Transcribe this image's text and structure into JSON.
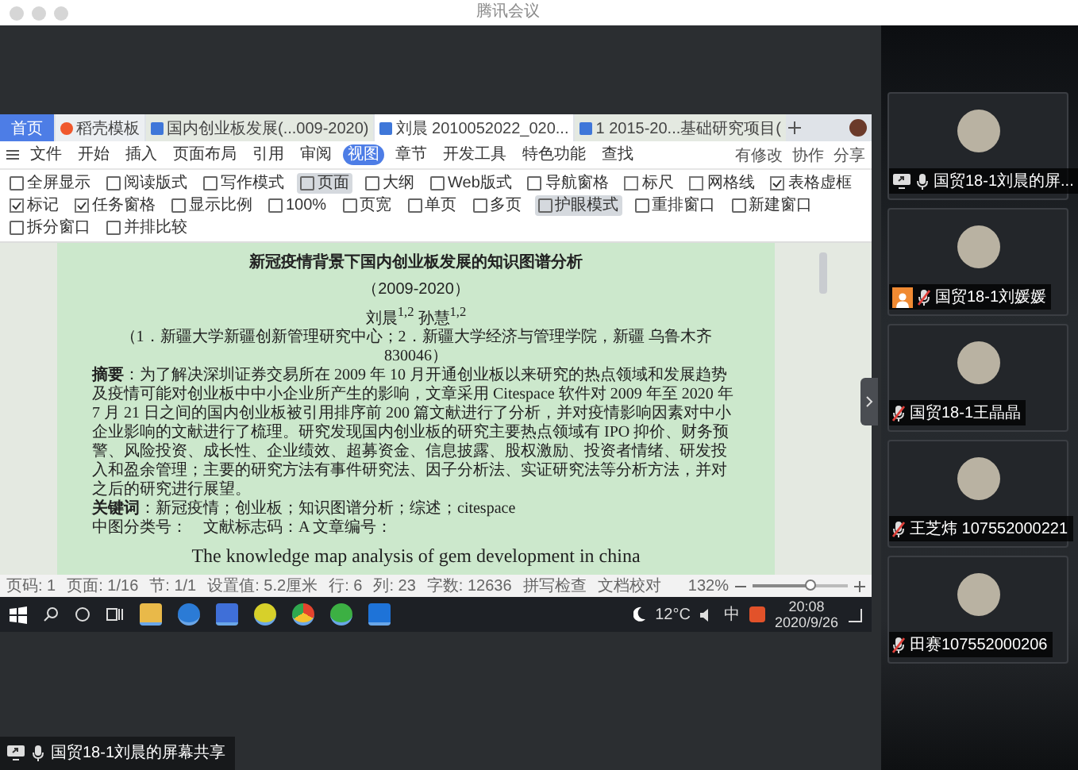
{
  "window": {
    "title": "腾讯会议"
  },
  "shared_screen": {
    "tabs": [
      {
        "label": "首页",
        "kind": "home",
        "selected": true
      },
      {
        "label": "稻壳模板",
        "kind": "docer",
        "selected": false
      },
      {
        "label": "国内创业板发展(...009-2020)",
        "kind": "doc",
        "selected": false
      },
      {
        "label": "刘晨 2010052022_020...",
        "kind": "doc",
        "selected": true
      },
      {
        "label": "1 2015-20...基础研究项目(",
        "kind": "doc",
        "selected": false
      }
    ],
    "menu": [
      {
        "label": "文件",
        "selected": false
      },
      {
        "label": "开始",
        "selected": false
      },
      {
        "label": "插入",
        "selected": false
      },
      {
        "label": "页面布局",
        "selected": false
      },
      {
        "label": "引用",
        "selected": false
      },
      {
        "label": "审阅",
        "selected": false
      },
      {
        "label": "视图",
        "selected": true
      },
      {
        "label": "章节",
        "selected": false
      },
      {
        "label": "开发工具",
        "selected": false
      },
      {
        "label": "特色功能",
        "selected": false
      },
      {
        "label": "查找",
        "selected": false
      }
    ],
    "menu_actions": [
      "有修改",
      "协作",
      "分享"
    ],
    "ribbon": [
      {
        "label": "全屏显示",
        "kind": "button",
        "selected": false
      },
      {
        "label": "阅读版式",
        "kind": "button",
        "selected": false
      },
      {
        "label": "写作模式",
        "kind": "button",
        "selected": false
      },
      {
        "label": "页面",
        "kind": "button",
        "selected": true
      },
      {
        "label": "大纲",
        "kind": "button",
        "selected": false
      },
      {
        "label": "Web版式",
        "kind": "button",
        "selected": false
      },
      {
        "label": "导航窗格",
        "kind": "button",
        "selected": false
      },
      {
        "label": "标尺",
        "kind": "checkbox",
        "checked": false
      },
      {
        "label": "网格线",
        "kind": "checkbox",
        "checked": false
      },
      {
        "label": "表格虚框",
        "kind": "checkbox",
        "checked": true
      },
      {
        "label": "标记",
        "kind": "checkbox",
        "checked": true
      },
      {
        "label": "任务窗格",
        "kind": "checkbox",
        "checked": true
      },
      {
        "label": "显示比例",
        "kind": "button",
        "selected": false
      },
      {
        "label": "100%",
        "kind": "button",
        "selected": false
      },
      {
        "label": "页宽",
        "kind": "button",
        "selected": false
      },
      {
        "label": "单页",
        "kind": "button",
        "selected": false
      },
      {
        "label": "多页",
        "kind": "button",
        "selected": false
      },
      {
        "label": "护眼模式",
        "kind": "button",
        "selected": true
      },
      {
        "label": "重排窗口",
        "kind": "button",
        "selected": false
      },
      {
        "label": "新建窗口",
        "kind": "button",
        "selected": false
      },
      {
        "label": "拆分窗口",
        "kind": "button",
        "selected": false
      },
      {
        "label": "并排比较",
        "kind": "button",
        "selected": false
      }
    ],
    "document": {
      "title": "新冠疫情背景下国内创业板发展的知识图谱分析",
      "subtitle": "（2009-2020）",
      "authors": "刘晨$^{1,2}$ 孙慧$^{1,2}$",
      "affiliation": "（1．新疆大学新疆创新管理研究中心；2．新疆大学经济与管理学院，新疆 乌鲁木齐 830046）",
      "abstract": "**摘要**：为了解决深圳证券交易所在 2009 年 10 月开通创业板以来研究的热点领域和发展趋势及疫情可能对创业板中中小企业所产生的影响，文章采用 Citespace 软件对 2009 年至 2020 年 7 月 21 日之间的国内创业板被引用排序前 200 篇文献进行了分析，并对疫情影响因素对中小企业影响的文献进行了梳理。研究发现国内创业板的研究主要热点领域有 IPO 抑价、财务预警、风险投资、成长性、企业绩效、超募资金、信息披露、股权激励、投资者情绪、研发投入和盈余管理；主要的研究方法有事件研究法、因子分析法、实证研究法等分析方法，并对之后的研究进行展望。",
      "keywords": "**关键词**：新冠疫情；创业板；知识图谱分析；综述；citespace",
      "classification": "中图分类号：　文献标志码：A 文章编号：",
      "english_title": "The knowledge map analysis of gem development in china"
    },
    "status_bar": {
      "items": [
        "页码: 1",
        "页面: 1/16",
        "节: 1/1",
        "设置值: 5.2厘米",
        "行: 6",
        "列: 23",
        "字数: 12636",
        "拼写检查",
        "文档校对"
      ],
      "zoom": "132%",
      "zoom_slider": {
        "level": 0.6
      }
    },
    "taskbar": {
      "weather": "12°C",
      "input_method": "中",
      "time": "20:08",
      "date": "2020/9/26"
    }
  },
  "participants": [
    {
      "name": "国贸18-1刘晨的屏...",
      "muted": false,
      "sharing": true,
      "badge": false
    },
    {
      "name": "国贸18-1刘媛媛",
      "muted": true,
      "sharing": false,
      "badge": true
    },
    {
      "name": "国贸18-1王晶晶",
      "muted": true,
      "sharing": false,
      "badge": false
    },
    {
      "name": "王芝炜 107552000221",
      "muted": true,
      "sharing": false,
      "badge": false
    },
    {
      "name": "田赛107552000206",
      "muted": true,
      "sharing": false,
      "badge": false
    }
  ],
  "share_label": {
    "text": "国贸18-1刘晨的屏幕共享"
  }
}
